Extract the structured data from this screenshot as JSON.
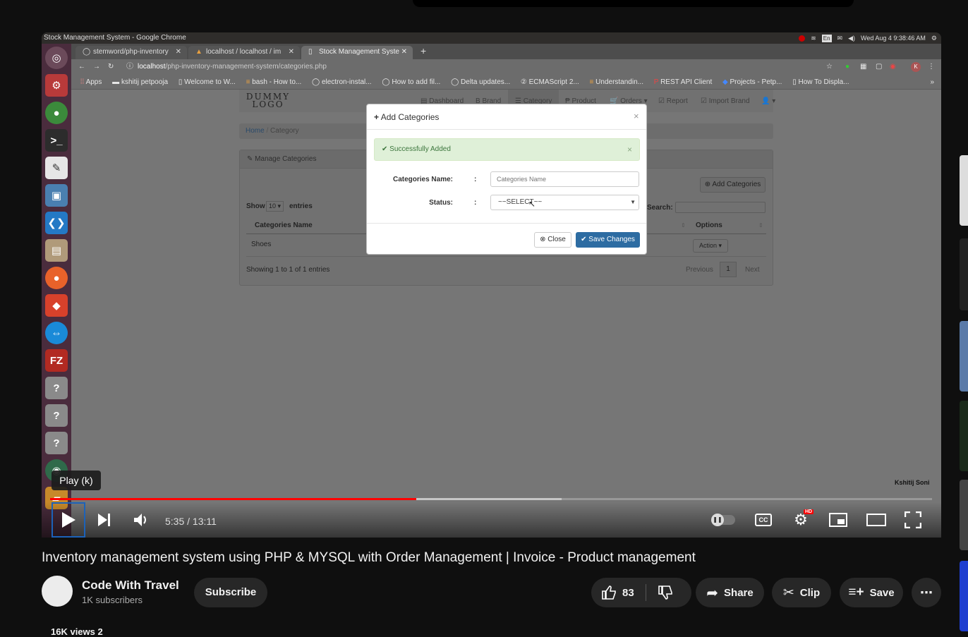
{
  "os": {
    "window_title": "Stock Management System - Google Chrome",
    "clock": "Wed Aug 4  9:38:46 AM",
    "keyboard": "En"
  },
  "browser": {
    "tabs": [
      {
        "label": "stemword/php-inventory"
      },
      {
        "label": "localhost / localhost / im"
      },
      {
        "label": "Stock Management Syste"
      }
    ],
    "url_host": "localhost",
    "url_path": "/php-inventory-management-system/categories.php",
    "bookmarks": [
      "Apps",
      "kshitij petpooja",
      "Welcome to W...",
      "bash - How to...",
      "electron-instal...",
      "How to add fil...",
      "Delta updates...",
      "ECMAScript 2...",
      "Understandin...",
      "REST API Client",
      "Projects - Petp...",
      "How To Displa..."
    ],
    "bookmarks_more": "»"
  },
  "app": {
    "logo": "DUMMY LOGO",
    "nav": [
      "Dashboard",
      "Brand",
      "Category",
      "Product",
      "Orders",
      "Report",
      "Import Brand"
    ],
    "breadcrumb_home": "Home",
    "breadcrumb_current": "Category",
    "panel_title": "Manage Categories",
    "add_button": "Add Categories",
    "show_label": "Show",
    "entries_value": "10",
    "entries_label": "entries",
    "search_label": "Search:",
    "col_name": "Categories Name",
    "col_options": "Options",
    "row_name": "Shoes",
    "row_action": "Action",
    "footer_info": "Showing 1 to 1 of 1 entries",
    "prev": "Previous",
    "page": "1",
    "next": "Next"
  },
  "modal": {
    "title": "Add Categories",
    "alert": "Successfully Added",
    "name_label": "Categories Name:",
    "name_placeholder": "Categories Name",
    "colon": ":",
    "status_label": "Status:",
    "status_value": "~~SELECT~~",
    "close": "Close",
    "save": "Save Changes"
  },
  "player": {
    "tooltip": "Play (k)",
    "watermark": "Kshitij Soni",
    "time": "5:35 / 13:11",
    "hd_badge": "HD",
    "progress_played": 0.415,
    "progress_buffered": 0.58
  },
  "video": {
    "title": "Inventory management system using PHP & MYSQL with Order Management | Invoice - Product management",
    "channel": "Code With Travel",
    "subscribers": "1K subscribers",
    "subscribe": "Subscribe",
    "likes": "83",
    "share": "Share",
    "clip": "Clip",
    "save": "Save",
    "more": "⋯",
    "views_partial": "16K views 2"
  },
  "colors": {
    "accent_red": "#ff0000",
    "alert_green": "#dff0d8",
    "save_blue": "#2d6ca2"
  }
}
